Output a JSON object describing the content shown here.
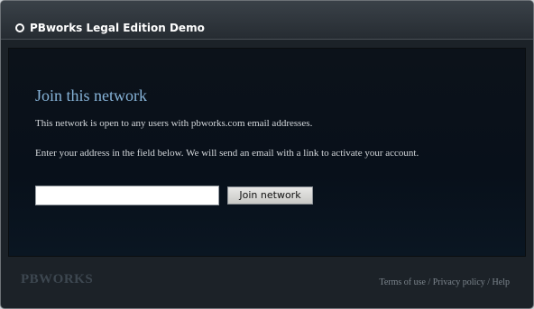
{
  "window": {
    "title": "PBworks Legal Edition Demo"
  },
  "main": {
    "heading": "Join this network",
    "info_text": "This network is open to any users with pbworks.com email addresses.",
    "instructions_text": "Enter your address in the field below. We will send an email with a link to activate your account.",
    "email_input": {
      "value": "",
      "placeholder": ""
    },
    "join_button_label": "Join network"
  },
  "footer": {
    "logo_text": "PBWORKS",
    "links": [
      {
        "label": "Terms of use"
      },
      {
        "label": "Privacy policy"
      },
      {
        "label": "Help"
      }
    ],
    "separator": "/"
  },
  "colors": {
    "heading": "#86b3d8",
    "background": "#1c2228",
    "content_background": "#08101a"
  }
}
